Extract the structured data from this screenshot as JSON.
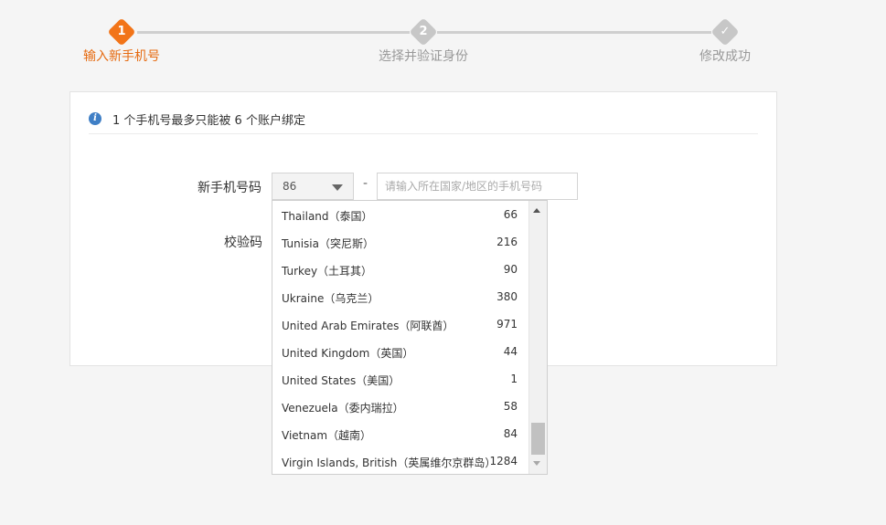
{
  "steps": [
    {
      "num": "1",
      "label": "输入新手机号",
      "state": "active"
    },
    {
      "num": "2",
      "label": "选择并验证身份",
      "state": "pending"
    },
    {
      "num": "✓",
      "label": "修改成功",
      "state": "pending"
    }
  ],
  "notice": {
    "icon": "info-icon",
    "text": "1 个手机号最多只能被 6 个账户绑定"
  },
  "form": {
    "phone_label": "新手机号码",
    "code_label": "校验码",
    "country_code": "86",
    "dash": "-",
    "phone_placeholder": "请输入所在国家/地区的手机号码"
  },
  "dropdown": {
    "options": [
      {
        "name": "Thailand（泰国）",
        "code": "66"
      },
      {
        "name": "Tunisia（突尼斯）",
        "code": "216"
      },
      {
        "name": "Turkey（土耳其）",
        "code": "90"
      },
      {
        "name": "Ukraine（乌克兰）",
        "code": "380"
      },
      {
        "name": "United Arab Emirates（阿联酋）",
        "code": "971"
      },
      {
        "name": "United Kingdom（英国）",
        "code": "44"
      },
      {
        "name": "United States（美国）",
        "code": "1"
      },
      {
        "name": "Venezuela（委内瑞拉）",
        "code": "58"
      },
      {
        "name": "Vietnam（越南）",
        "code": "84"
      },
      {
        "name": "Virgin Islands, British（英属维尔京群岛）",
        "code": "1284"
      }
    ]
  },
  "colors": {
    "accent": "#f27418",
    "inactive_step": "#c7c7c7",
    "info": "#3f7fc6"
  }
}
